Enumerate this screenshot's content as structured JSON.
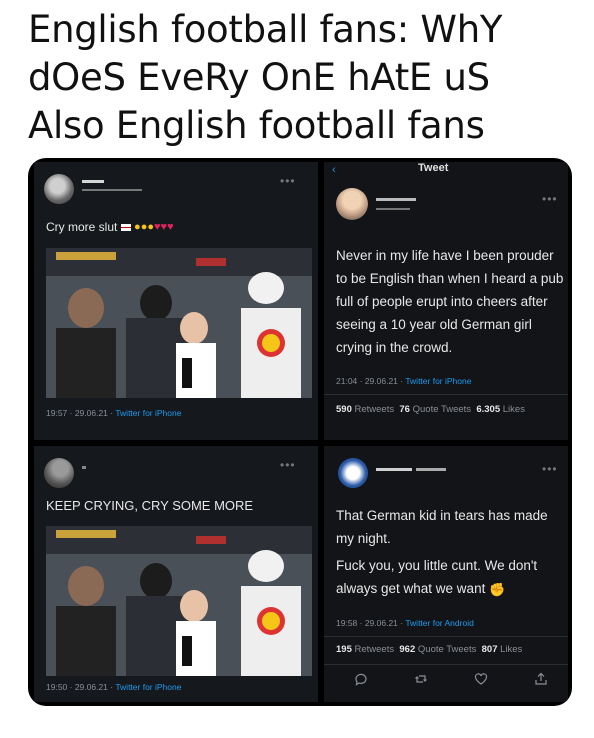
{
  "caption": {
    "line1": "English football fans: WhY",
    "line2": "dOeS EveRy OnE hAtE uS",
    "line3": "Also English football fans"
  },
  "panel1": {
    "text": "Cry more slut",
    "meta_time": "19:57 · 29.06.21 · ",
    "meta_source": "Twitter for iPhone"
  },
  "panel2": {
    "header": "Tweet",
    "text": "Never in my life have I been prouder to be English than when I heard a pub full of people erupt into cheers after seeing a 10 year old German girl crying in the crowd.",
    "meta_time": "21:04 · 29.06.21 · ",
    "meta_source": "Twitter for iPhone",
    "retweets": "590",
    "retweets_label": "Retweets",
    "quotes": "76",
    "quotes_label": "Quote Tweets",
    "likes": "6.305",
    "likes_label": "Likes"
  },
  "panel3": {
    "text": "KEEP CRYING, CRY SOME MORE",
    "meta_time": "19:50 · 29.06.21 · ",
    "meta_source": "Twitter for iPhone"
  },
  "panel4": {
    "text1": "That German kid in tears has made my night.",
    "text2": "Fuck you, you little cunt.  We don't always get what we want",
    "meta_time": "19:58 · 29.06.21 · ",
    "meta_source": "Twitter for Android",
    "retweets": "195",
    "retweets_label": "Retweets",
    "quotes": "962",
    "quotes_label": "Quote Tweets",
    "likes": "807",
    "likes_label": "Likes"
  },
  "colors": {
    "accent": "#1d9bf0",
    "panel_bg": "#15181c",
    "board_bg": "#000000"
  },
  "icons": [
    "back-arrow-icon",
    "more-dots-icon",
    "reply-icon",
    "retweet-icon",
    "like-icon",
    "share-icon",
    "flexed-bicep-emoji",
    "crying-emoji",
    "heart-emoji"
  ]
}
